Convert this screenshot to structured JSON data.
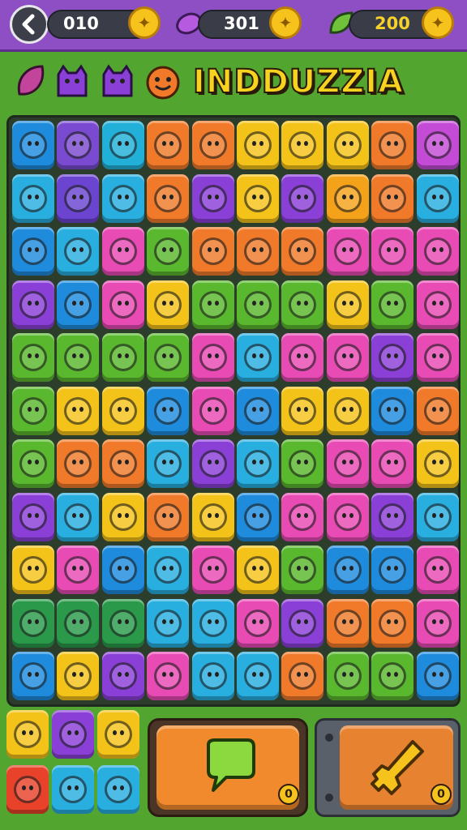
{
  "topbar": {
    "resources": [
      {
        "name": "potion",
        "value": "010",
        "color": "#f6c21c"
      },
      {
        "name": "candy",
        "value": "301",
        "color": "#b65be0"
      },
      {
        "name": "leaf",
        "value": "200",
        "color": "#f6c21c"
      }
    ]
  },
  "header": {
    "title": "INDDUZZIA",
    "mini_icons": [
      {
        "icon": "leaf-icon",
        "color": "#c2459b"
      },
      {
        "icon": "monster-icon",
        "color": "#8a3fd6"
      },
      {
        "icon": "monster-icon",
        "color": "#8a3fd6"
      },
      {
        "icon": "face-icon",
        "color": "#f07a2a"
      }
    ]
  },
  "board": {
    "rows": [
      [
        "#1e8bdd",
        "#7a4bd0",
        "#22b0d8",
        "#f07a2a",
        "#f07a2a",
        "#f4c31a",
        "#f4c31a",
        "#f4c31a",
        "#f07a2a",
        "#c44bd6"
      ],
      [
        "#29aee0",
        "#6b45d0",
        "#29aee0",
        "#f07a2a",
        "#8a3fd6",
        "#f4c31a",
        "#8a3fd6",
        "#f4a21a",
        "#f07a2a",
        "#29aee0"
      ],
      [
        "#1e8bdd",
        "#29aee0",
        "#e84bb4",
        "#5ab82e",
        "#f07a2a",
        "#f07a2a",
        "#f07a2a",
        "#e84bb4",
        "#e84bb4",
        "#e84bb4"
      ],
      [
        "#8a3fd6",
        "#1e8bdd",
        "#e84bb4",
        "#f4c31a",
        "#5ab82e",
        "#5ab82e",
        "#5ab82e",
        "#f4c31a",
        "#5ab82e",
        "#e84bb4"
      ],
      [
        "#5ab82e",
        "#5ab82e",
        "#5ab82e",
        "#5ab82e",
        "#e84bb4",
        "#29aee0",
        "#e84bb4",
        "#e84bb4",
        "#8a3fd6",
        "#e84bb4"
      ],
      [
        "#5ab82e",
        "#f4c31a",
        "#f4c31a",
        "#1e8bdd",
        "#e84bb4",
        "#1e8bdd",
        "#f4c31a",
        "#f4c31a",
        "#1e8bdd",
        "#f07a2a"
      ],
      [
        "#5ab82e",
        "#f07a2a",
        "#f07a2a",
        "#29aee0",
        "#8a3fd6",
        "#29aee0",
        "#5ab82e",
        "#e84bb4",
        "#e84bb4",
        "#f4c31a"
      ],
      [
        "#8a3fd6",
        "#29aee0",
        "#f4c31a",
        "#f07a2a",
        "#f4c31a",
        "#1e8bdd",
        "#e84bb4",
        "#e84bb4",
        "#8a3fd6",
        "#29aee0"
      ],
      [
        "#f4c31a",
        "#e84bb4",
        "#1e8bdd",
        "#29aee0",
        "#e84bb4",
        "#f4c31a",
        "#5ab82e",
        "#1e8bdd",
        "#1e8bdd",
        "#e84bb4"
      ],
      [
        "#2a9a4a",
        "#2a9a4a",
        "#2a9a4a",
        "#29aee0",
        "#29aee0",
        "#e84bb4",
        "#8a3fd6",
        "#f07a2a",
        "#f07a2a",
        "#e84bb4"
      ],
      [
        "#1e8bdd",
        "#f4c31a",
        "#8a3fd6",
        "#e84bb4",
        "#29aee0",
        "#29aee0",
        "#f07a2a",
        "#5ab82e",
        "#5ab82e",
        "#1e8bdd"
      ]
    ]
  },
  "reserve": {
    "tiles": [
      [
        "#f4c31a",
        "#8a3fd6",
        "#f4c31a"
      ],
      [
        "#e8422a",
        "#29aee0",
        "#29aee0"
      ]
    ]
  },
  "actions": {
    "chat_icon": "speech-bubble-icon",
    "tool_icon": "key-icon",
    "chat_count": "0",
    "tool_count": "0"
  }
}
